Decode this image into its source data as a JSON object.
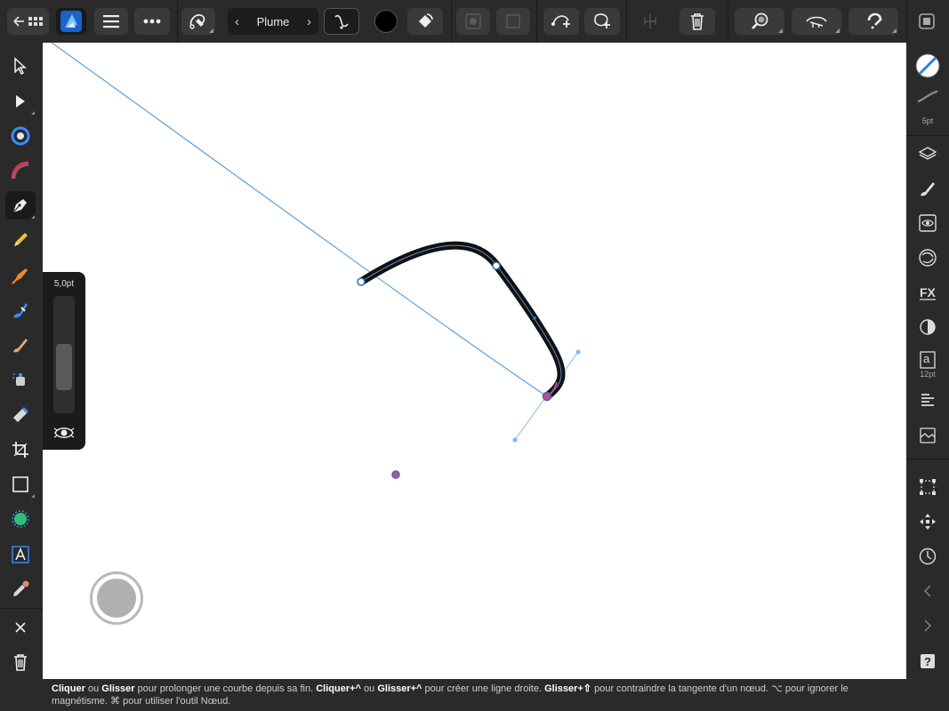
{
  "toolbar": {
    "persona_label": "Plume",
    "fill_color": "#000000",
    "accent": "#2f7fe0"
  },
  "width_panel": {
    "value_label": "5,0pt",
    "level_fraction": 0.3
  },
  "right_panel": {
    "stroke_width_label": "5pt",
    "font_size_label": "12pt",
    "text_glyph": "a"
  },
  "status": {
    "w1": "Cliquer",
    "t1": " ou ",
    "w2": "Glisser",
    "t2": " pour prolonger une courbe depuis sa fin. ",
    "w3": "Cliquer+^",
    "t3": " ou ",
    "w4": "Glisser+^",
    "t4": " pour créer une ligne droite. ",
    "w5": "Glisser+⇧",
    "t5": " pour contraindre la tangente d'un nœud. ⌥ pour ignorer le magnétisme. ⌘ pour utiliser l'outil Nœud."
  },
  "icons": {
    "top": [
      "back-grid-icon",
      "affinity-logo-icon",
      "menu-icon",
      "more-icon",
      "pen-mode-icon",
      "chevron-left-icon",
      "chevron-right-icon",
      "curve-mode-icon",
      "fill-icon",
      "transparency-icon",
      "solid-shape-icon",
      "add-node-icon",
      "add-shape-icon",
      "align-icon",
      "trash-icon",
      "zoom-icon",
      "view-mode-icon",
      "snapping-icon",
      "share-icon"
    ],
    "left": [
      "move-icon",
      "node-icon",
      "corner-icon",
      "gradient-icon",
      "pen-icon",
      "pencil-icon",
      "vector-brush-icon",
      "fill-brush-icon",
      "paint-brush-icon",
      "eraser-icon",
      "sprayer-icon",
      "crop-icon",
      "rectangle-icon",
      "shape-icon",
      "text-icon",
      "eyedropper-icon",
      "close-icon",
      "delete-icon"
    ],
    "right": [
      "stroke-color-icon",
      "stroke-width-icon",
      "layers-icon",
      "brushes-icon",
      "appearance-icon",
      "symbols-icon",
      "fx-icon",
      "styles-icon",
      "text-icon",
      "paragraph-icon",
      "navigator-icon",
      "transform-icon",
      "move-icon",
      "history-icon",
      "collapse-left-icon",
      "collapse-right-icon",
      "help-icon"
    ]
  }
}
